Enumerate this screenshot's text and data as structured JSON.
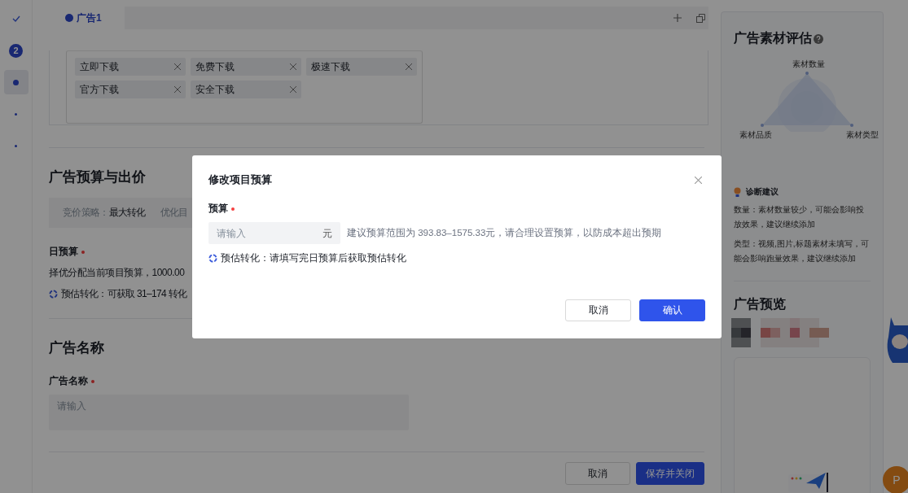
{
  "steps": [
    {
      "kind": "check",
      "selected": false
    },
    {
      "kind": "number",
      "label": "2",
      "selected": false
    },
    {
      "kind": "dot",
      "selected": true
    },
    {
      "kind": "dot",
      "selected": false
    },
    {
      "kind": "dot",
      "selected": false
    }
  ],
  "tabs": [
    {
      "label": "广告1",
      "selected": true
    }
  ],
  "tags": [
    {
      "label": "立即下载"
    },
    {
      "label": "免费下载"
    },
    {
      "label": "极速下载"
    },
    {
      "label": "官方下载"
    },
    {
      "label": "安全下载"
    }
  ],
  "budget_section": {
    "title": "广告预算与出价",
    "strategy_label": "竞价策略：",
    "strategy_value": "最大转化",
    "optimize_label": "优化目",
    "daily_label": "日预算",
    "required": true,
    "daily_text": "择优分配当前项目预算，1000.00",
    "estimate": "预估转化：可获取 31–174 转化"
  },
  "name_section": {
    "title": "广告名称",
    "field_label": "广告名称",
    "required": true,
    "placeholder": "请输入"
  },
  "footer_buttons": [
    {
      "label": "取消",
      "kind": "secondary"
    },
    {
      "label": "保存并关闭",
      "kind": "primary"
    }
  ],
  "evaluation": {
    "title": "广告素材评估",
    "axes": [
      "素材数量",
      "素材品质",
      "素材类型"
    ],
    "advice_title": "诊断建议",
    "advice": [
      "数量：素材数量较少，可能会影响投放效果，建议继续添加",
      "类型：视频,图片,标题素材未填写，可能会影响跑量效果，建议继续添加"
    ]
  },
  "preview": {
    "title": "广告预览"
  },
  "avatar": "P",
  "modal": {
    "title": "修改项目预算",
    "field_label": "预算",
    "required": true,
    "placeholder": "请输入",
    "unit": "元",
    "hint": "建议预算范围为 393.83–1575.33元，请合理设置预算，以防成本超出预期",
    "estimate": "预估转化：请填写完日预算后获取预估转化",
    "buttons": [
      {
        "label": "取消",
        "kind": "secondary"
      },
      {
        "label": "确认",
        "kind": "primary"
      }
    ]
  }
}
